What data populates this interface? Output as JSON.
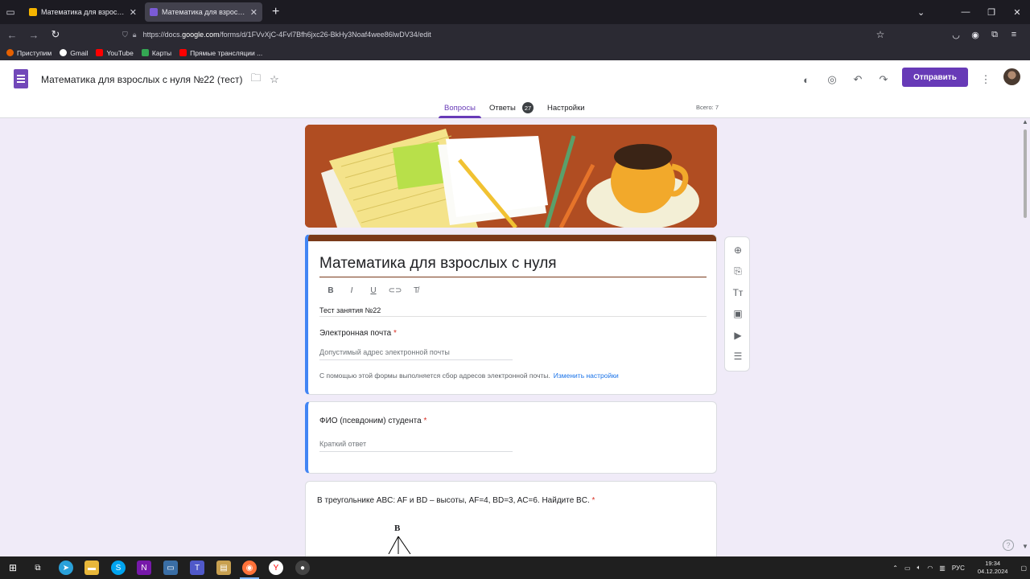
{
  "browser": {
    "tabs": [
      {
        "title": "Математика для взрослых ве",
        "active": false,
        "favicon": "slides-icon"
      },
      {
        "title": "Математика для взрослых с н",
        "active": true,
        "favicon": "forms-icon"
      }
    ],
    "url_prefix": "https://docs.",
    "url_domain": "google.com",
    "url_rest": "/forms/d/1FVvXjC-4Fvl7Bfh6jxc26-BkHy3Noaf4wee86lwDV34/edit",
    "bookmarks": [
      {
        "label": "Приступим",
        "icon": "firefox-icon"
      },
      {
        "label": "Gmail",
        "icon": "google-icon"
      },
      {
        "label": "YouTube",
        "icon": "youtube-icon"
      },
      {
        "label": "Карты",
        "icon": "maps-icon"
      },
      {
        "label": "Прямые трансляции ...",
        "icon": "youtube-icon"
      }
    ]
  },
  "header": {
    "doc_title": "Математика для взрослых с нуля №22 (тест)",
    "send_label": "Отправить",
    "tabs": {
      "questions": "Вопросы",
      "responses": "Ответы",
      "settings": "Настройки"
    },
    "responses_count": "27",
    "total": "Всего: 7"
  },
  "form": {
    "title": "Математика для взрослых с нуля",
    "description": "Тест занятия №22",
    "email_label": "Электронная почта",
    "email_placeholder": "Допустимый адрес электронной почты",
    "collect_notice": "С помощью этой формы выполняется сбор адресов электронной почты.",
    "collect_link": "Изменить настройки",
    "required_mark": "*",
    "q2_label": "ФИО (псевдоним) студента",
    "q2_placeholder": "Краткий ответ",
    "q3_text": "В треугольнике ABC: AF и BD – высоты, AF=4, BD=3, AC=6. Найдите BC.",
    "q3_figure_vertex": "B"
  },
  "taskbar": {
    "lang": "РУС",
    "time": "19:34",
    "date": "04.12.2024"
  },
  "colors": {
    "accent": "#673ab7",
    "focus": "#4285f4",
    "required": "#d93025",
    "link": "#1a73e8",
    "theme_bar": "#7a3a1a"
  }
}
